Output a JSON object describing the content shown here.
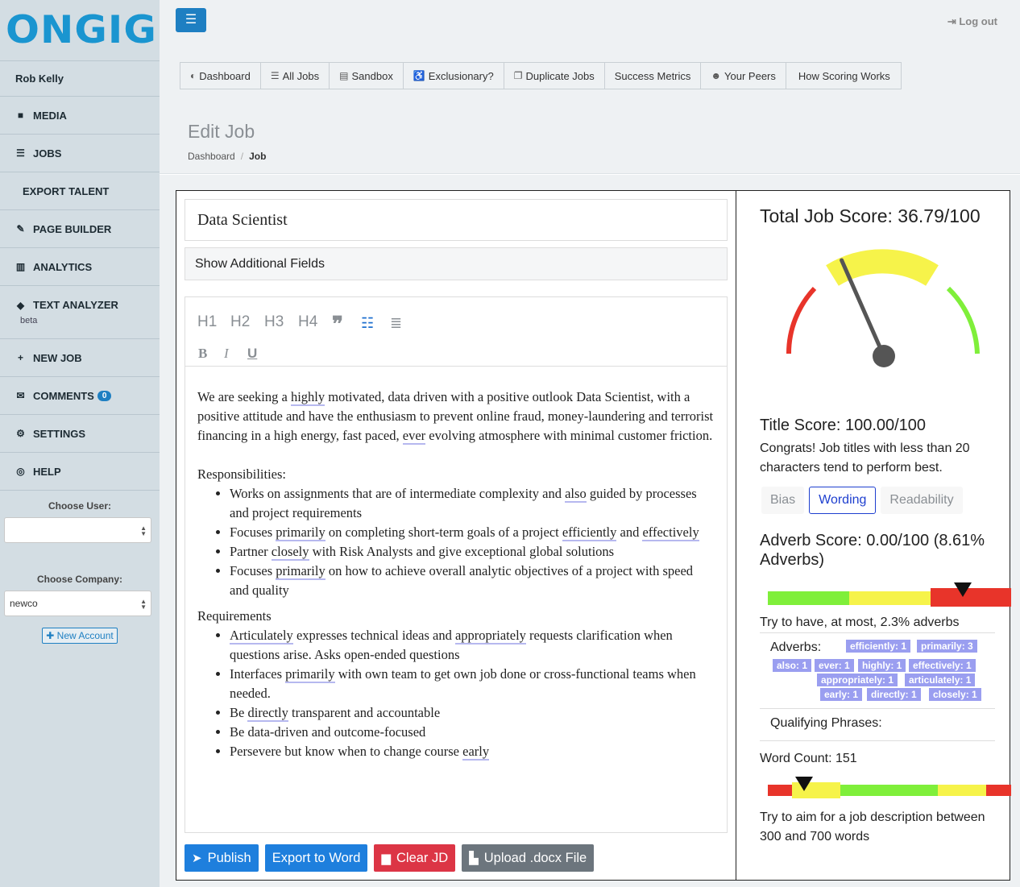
{
  "brand": {
    "logo_text": "ONGIG"
  },
  "sidebar": {
    "user_name": "Rob Kelly",
    "items": [
      {
        "label": "MEDIA",
        "icon": "video-icon"
      },
      {
        "label": "JOBS",
        "icon": "list-icon"
      },
      {
        "label": "EXPORT TALENT",
        "icon": ""
      },
      {
        "label": "PAGE BUILDER",
        "icon": "wrench-icon"
      },
      {
        "label": "ANALYTICS",
        "icon": "bar-chart-icon"
      },
      {
        "label": "TEXT ANALYZER",
        "sub": "beta",
        "icon": "graduation-cap-icon"
      },
      {
        "label": "NEW JOB",
        "icon": "plus-icon"
      },
      {
        "label": "COMMENTS",
        "badge": "0",
        "icon": "envelope-icon"
      },
      {
        "label": "SETTINGS",
        "icon": "gear-icon"
      },
      {
        "label": "HELP",
        "icon": "lifebuoy-icon"
      }
    ],
    "choose_user_label": "Choose User:",
    "choose_user_value": "",
    "choose_company_label": "Choose Company:",
    "choose_company_value": "newco",
    "new_account_label": "New Account"
  },
  "topbar": {
    "logout_label": "Log out",
    "nav": [
      "Dashboard",
      "All Jobs",
      "Sandbox",
      "Exclusionary?",
      "Duplicate Jobs",
      "Success Metrics",
      "Your Peers",
      "How Scoring Works"
    ],
    "page_title": "Edit Job",
    "breadcrumb": [
      "Dashboard",
      "Job"
    ]
  },
  "editor": {
    "job_title": "Data Scientist",
    "additional_fields_label": "Show Additional Fields",
    "toolbar": {
      "h1": "H1",
      "h2": "H2",
      "h3": "H3",
      "h4": "H4",
      "bold": "B",
      "italic": "I",
      "underline": "U"
    },
    "intro": [
      {
        "t": "We are seeking a "
      },
      {
        "t": "highly",
        "hl": true
      },
      {
        "t": " motivated, data driven with a positive outlook Data Scientist, with a positive attitude and have the enthusiasm to prevent online fraud, money-laundering and terrorist financing in a high energy, fast paced, "
      },
      {
        "t": "ever",
        "hl": true
      },
      {
        "t": " evolving atmosphere with minimal customer friction."
      }
    ],
    "responsibilities_heading": "Responsibilities:",
    "responsibilities": [
      [
        {
          "t": "Works on assignments that are of intermediate complexity and "
        },
        {
          "t": "also",
          "hl": true
        },
        {
          "t": " guided by processes and project requirements"
        }
      ],
      [
        {
          "t": "Focuses "
        },
        {
          "t": "primarily",
          "hl": true
        },
        {
          "t": " on completing short-term goals of a project "
        },
        {
          "t": "efficiently",
          "hl": true
        },
        {
          "t": " and "
        },
        {
          "t": "effectively",
          "hl": true
        }
      ],
      [
        {
          "t": "Partner "
        },
        {
          "t": "closely",
          "hl": true
        },
        {
          "t": " with Risk Analysts and give exceptional global solutions"
        }
      ],
      [
        {
          "t": "Focuses "
        },
        {
          "t": "primarily",
          "hl": true
        },
        {
          "t": " on how to achieve overall analytic objectives of a project with speed and quality"
        }
      ]
    ],
    "requirements_heading": "Requirements",
    "requirements": [
      [
        {
          "t": " "
        },
        {
          "t": "Articulately",
          "hl": true
        },
        {
          "t": " expresses technical ideas and "
        },
        {
          "t": "appropriately",
          "hl": true
        },
        {
          "t": " requests clarification when questions arise. Asks open-ended questions"
        }
      ],
      [
        {
          "t": "Interfaces "
        },
        {
          "t": "primarily",
          "hl": true
        },
        {
          "t": " with own team to get own job done or cross-functional teams when needed."
        }
      ],
      [
        {
          "t": "Be "
        },
        {
          "t": "directly",
          "hl": true
        },
        {
          "t": " transparent and accountable"
        }
      ],
      [
        {
          "t": "Be data-driven and outcome-focused"
        }
      ],
      [
        {
          "t": "Persevere but know when to change course "
        },
        {
          "t": "early",
          "hl": true
        }
      ]
    ],
    "buttons": {
      "publish": "Publish",
      "export": "Export to Word",
      "clear": "Clear JD",
      "upload": "Upload .docx File"
    }
  },
  "score": {
    "total_label": "Total Job Score: 36.79/100",
    "total_value": 36.79,
    "title_score_label": "Title Score: 100.00/100",
    "title_advice": "Congrats! Job titles with less than 20 characters tend to perform best.",
    "tabs": [
      "Bias",
      "Wording",
      "Readability"
    ],
    "active_tab": "Wording",
    "adverb_score_label": "Adverb Score: 0.00/100 (8.61% Adverbs)",
    "adverb_advice": "Try to have, at most, 2.3% adverbs",
    "adverbs_label": "Adverbs:",
    "adverbs": [
      "efficiently: 1",
      "primarily: 3",
      "also: 1",
      "ever: 1",
      "highly: 1",
      "effectively: 1",
      "appropriately: 1",
      "articulately: 1",
      "early: 1",
      "directly: 1",
      "closely: 1"
    ],
    "qualifying_label": "Qualifying Phrases:",
    "word_count_label": "Word Count: 151",
    "word_count_advice": "Try to aim for a job description between 300 and 700 words",
    "colors": {
      "red": "#e8342a",
      "yellow": "#f6f34a",
      "green": "#7fef3a",
      "needle": "#555555"
    }
  }
}
